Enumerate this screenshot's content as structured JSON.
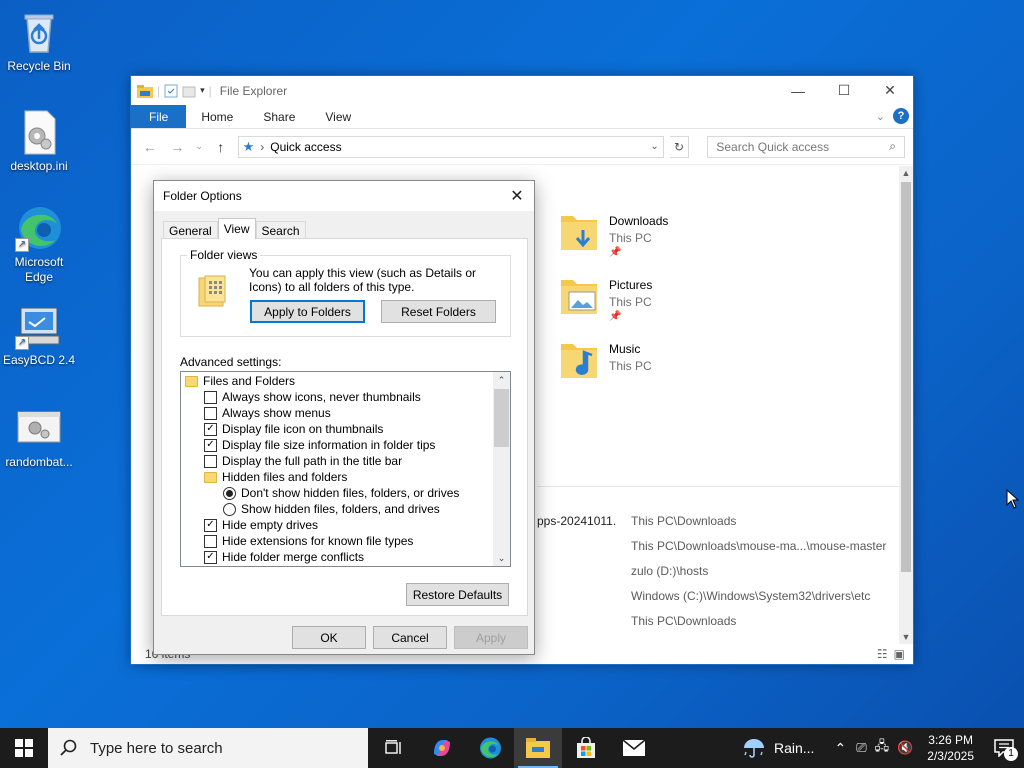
{
  "desktop": {
    "icons": [
      {
        "label": "Recycle Bin"
      },
      {
        "label": "desktop.ini"
      },
      {
        "label": "Microsoft Edge"
      },
      {
        "label": "EasyBCD 2.4"
      },
      {
        "label": "randombat..."
      }
    ]
  },
  "explorer": {
    "title": "File Explorer",
    "ribbon_tabs": [
      "File",
      "Home",
      "Share",
      "View"
    ],
    "address": {
      "location": "Quick access"
    },
    "search_placeholder": "Search Quick access",
    "frequent": [
      {
        "name": "Downloads",
        "location": "This PC",
        "icon": "downloads-folder-icon"
      },
      {
        "name": "Pictures",
        "location": "This PC",
        "icon": "pictures-folder-icon"
      },
      {
        "name": "Music",
        "location": "This PC",
        "icon": "music-folder-icon"
      }
    ],
    "recent": [
      {
        "name": "pps-20241011...",
        "location": "This PC\\Downloads"
      },
      {
        "name": "",
        "location": "This PC\\Downloads\\mouse-ma...\\mouse-master"
      },
      {
        "name": "",
        "location": "zulo (D:)\\hosts"
      },
      {
        "name": "",
        "location": "Windows (C:)\\Windows\\System32\\drivers\\etc"
      },
      {
        "name": "",
        "location": "This PC\\Downloads"
      }
    ],
    "status": "16 items"
  },
  "dialog": {
    "title": "Folder Options",
    "tabs": [
      "General",
      "View",
      "Search"
    ],
    "active_tab": "View",
    "folder_views": {
      "legend": "Folder views",
      "description": "You can apply this view (such as Details or Icons) to all folders of this type.",
      "apply_button": "Apply to Folders",
      "reset_button": "Reset Folders"
    },
    "advanced_label": "Advanced settings:",
    "advanced_items": [
      {
        "type": "folder",
        "label": "Files and Folders",
        "indent": 0
      },
      {
        "type": "checkbox",
        "label": "Always show icons, never thumbnails",
        "checked": false,
        "indent": 1
      },
      {
        "type": "checkbox",
        "label": "Always show menus",
        "checked": false,
        "indent": 1
      },
      {
        "type": "checkbox",
        "label": "Display file icon on thumbnails",
        "checked": true,
        "indent": 1
      },
      {
        "type": "checkbox",
        "label": "Display file size information in folder tips",
        "checked": true,
        "indent": 1
      },
      {
        "type": "checkbox",
        "label": "Display the full path in the title bar",
        "checked": false,
        "indent": 1
      },
      {
        "type": "folder",
        "label": "Hidden files and folders",
        "indent": 1
      },
      {
        "type": "radio",
        "label": "Don't show hidden files, folders, or drives",
        "checked": true,
        "indent": 2
      },
      {
        "type": "radio",
        "label": "Show hidden files, folders, and drives",
        "checked": false,
        "indent": 2
      },
      {
        "type": "checkbox",
        "label": "Hide empty drives",
        "checked": true,
        "indent": 1
      },
      {
        "type": "checkbox",
        "label": "Hide extensions for known file types",
        "checked": false,
        "indent": 1
      },
      {
        "type": "checkbox",
        "label": "Hide folder merge conflicts",
        "checked": true,
        "indent": 1
      }
    ],
    "restore_defaults": "Restore Defaults",
    "ok": "OK",
    "cancel": "Cancel",
    "apply": "Apply"
  },
  "taskbar": {
    "search_placeholder": "Type here to search",
    "weather": "Rain...",
    "time": "3:26 PM",
    "date": "2/3/2025",
    "notification_count": "1"
  },
  "colors": {
    "accent": "#1a6fc7",
    "desktop": "#0b5fc4",
    "taskbar": "#1c1c1c"
  }
}
